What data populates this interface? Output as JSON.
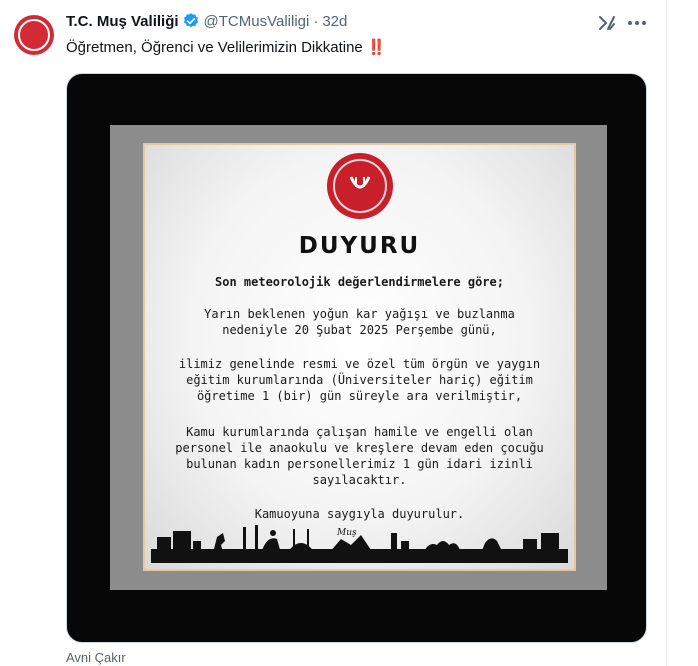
{
  "tweet": {
    "author_name": "T.C. Muş Valiliği",
    "handle": "@TCMusValiligi",
    "separator": "·",
    "time": "32d",
    "text": "Öğretmen, Öğrenci ve Velilerimizin Dikkatine",
    "text_emoji": "‼️",
    "verified_badge_icon": "verified-check-icon",
    "accent_color": "#1d9bf0"
  },
  "poster": {
    "title": "DUYURU",
    "lines": [
      "Son meteorolojik değerlendirmelere göre;",
      "Yarın beklenen yoğun kar yağışı ve buzlanma",
      "nedeniyle 20 Şubat 2025 Perşembe günü,",
      "ilimiz genelinde resmi ve özel tüm örgün ve yaygın",
      "eğitim kurumlarında (Üniversiteler hariç) eğitim",
      "öğretime 1 (bir) gün süreyle ara verilmiştir,",
      "Kamu kurumlarında çalışan hamile ve engelli olan",
      "personel ile anaokulu ve kreşlere devam eden çocuğu",
      "bulunan kadın personellerimiz 1 gün idari izinli",
      "sayılacaktır.",
      "Kamuoyuna saygıyla duyurulur."
    ],
    "skyline_text": "Muş",
    "emblem_color": "#c8202b"
  },
  "credit": "Avni Çakır"
}
